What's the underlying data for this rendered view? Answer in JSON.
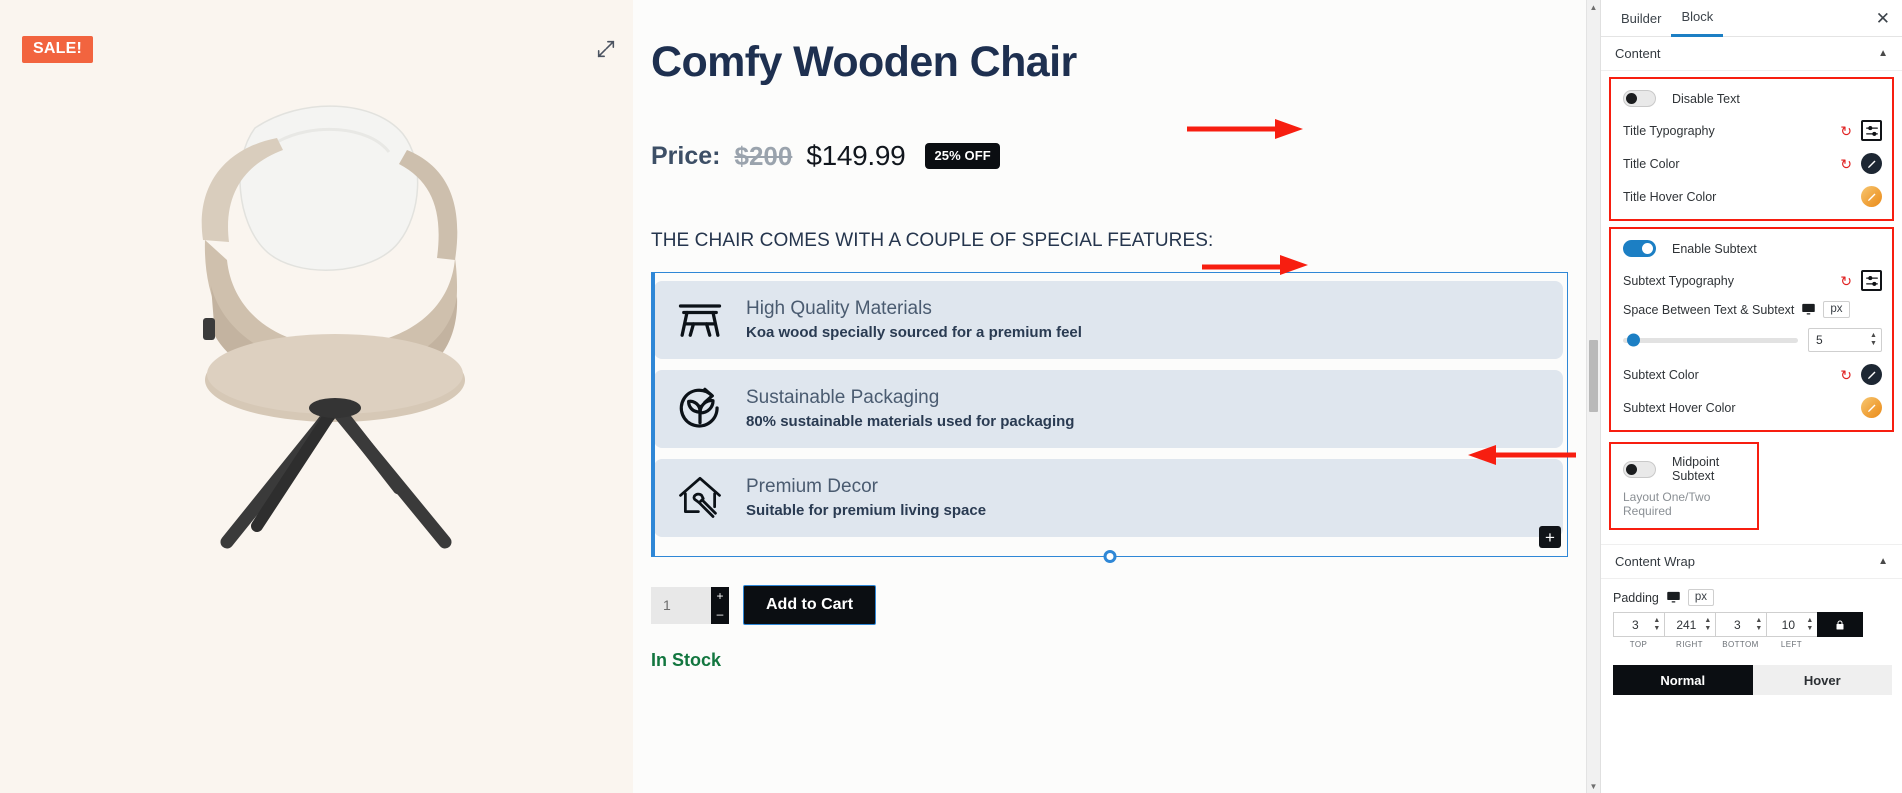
{
  "product": {
    "sale_badge": "SALE!",
    "expand_icon": "expand-icon",
    "title": "Comfy Wooden Chair",
    "price_label": "Price:",
    "price_old": "$200",
    "price_new": "$149.99",
    "discount_badge": "25% OFF",
    "features_heading": "THE CHAIR COMES WITH A COUPLE OF SPECIAL FEATURES:",
    "features": [
      {
        "icon": "picnic-table-icon",
        "title": "High Quality Materials",
        "subtext": "Koa wood specially sourced for a premium feel"
      },
      {
        "icon": "recycle-plant-icon",
        "title": "Sustainable Packaging",
        "subtext": "80% sustainable materials used for packaging"
      },
      {
        "icon": "house-paintbrush-icon",
        "title": "Premium Decor",
        "subtext": "Suitable for premium living space"
      }
    ],
    "add_block_label": "+",
    "quantity": "1",
    "qty_increase": "+",
    "qty_decrease": "–",
    "add_to_cart": "Add to Cart",
    "stock_status": "In Stock"
  },
  "sidebar": {
    "tabs": [
      {
        "label": "Builder",
        "active": false
      },
      {
        "label": "Block",
        "active": true
      }
    ],
    "close_label": "✕",
    "sections": [
      {
        "label": "Content",
        "collapse_icon": "chevron-up-icon"
      },
      {
        "label": "Content Wrap",
        "collapse_icon": "chevron-up-icon"
      }
    ],
    "text_group": {
      "disable_text": {
        "label": "Disable Text",
        "on": false
      },
      "title_typography": {
        "label": "Title Typography",
        "reset_icon": "reset-icon",
        "control_icon": "typography-icon"
      },
      "title_color": {
        "label": "Title Color",
        "reset_icon": "reset-icon",
        "swatch": "color-swatch-dark"
      },
      "title_hover_color": {
        "label": "Title Hover Color",
        "swatch": "color-swatch-orange"
      }
    },
    "subtext_group": {
      "enable_subtext": {
        "label": "Enable Subtext",
        "on": true
      },
      "subtext_typography": {
        "label": "Subtext Typography",
        "reset_icon": "reset-icon",
        "control_icon": "typography-icon"
      },
      "space_between": {
        "label": "Space Between Text & Subtext",
        "device_icon": "desktop-icon",
        "unit": "px",
        "value": "5",
        "slider_percent": 3
      },
      "subtext_color": {
        "label": "Subtext Color",
        "reset_icon": "reset-icon",
        "swatch": "color-swatch-dark"
      },
      "subtext_hover_color": {
        "label": "Subtext Hover Color",
        "swatch": "color-swatch-orange"
      }
    },
    "midpoint_group": {
      "midpoint_subtext": {
        "label": "Midpoint Subtext",
        "on": false
      },
      "note": "Layout One/Two Required"
    },
    "content_wrap": {
      "padding_label": "Padding",
      "device_icon": "desktop-icon",
      "unit": "px",
      "values": [
        {
          "value": "3",
          "caption": "TOP"
        },
        {
          "value": "241",
          "caption": "RIGHT"
        },
        {
          "value": "3",
          "caption": "BOTTOM"
        },
        {
          "value": "10",
          "caption": "LEFT"
        }
      ],
      "lock_icon": "lock-icon",
      "states": [
        {
          "label": "Normal",
          "active": true
        },
        {
          "label": "Hover",
          "active": false
        }
      ]
    }
  },
  "colors": {
    "accent_blue": "#1c7fc4",
    "annotation_red": "#f71e10",
    "sale_orange": "#f2643f",
    "stock_green": "#12763f",
    "feature_bg": "#dfe6ee"
  }
}
